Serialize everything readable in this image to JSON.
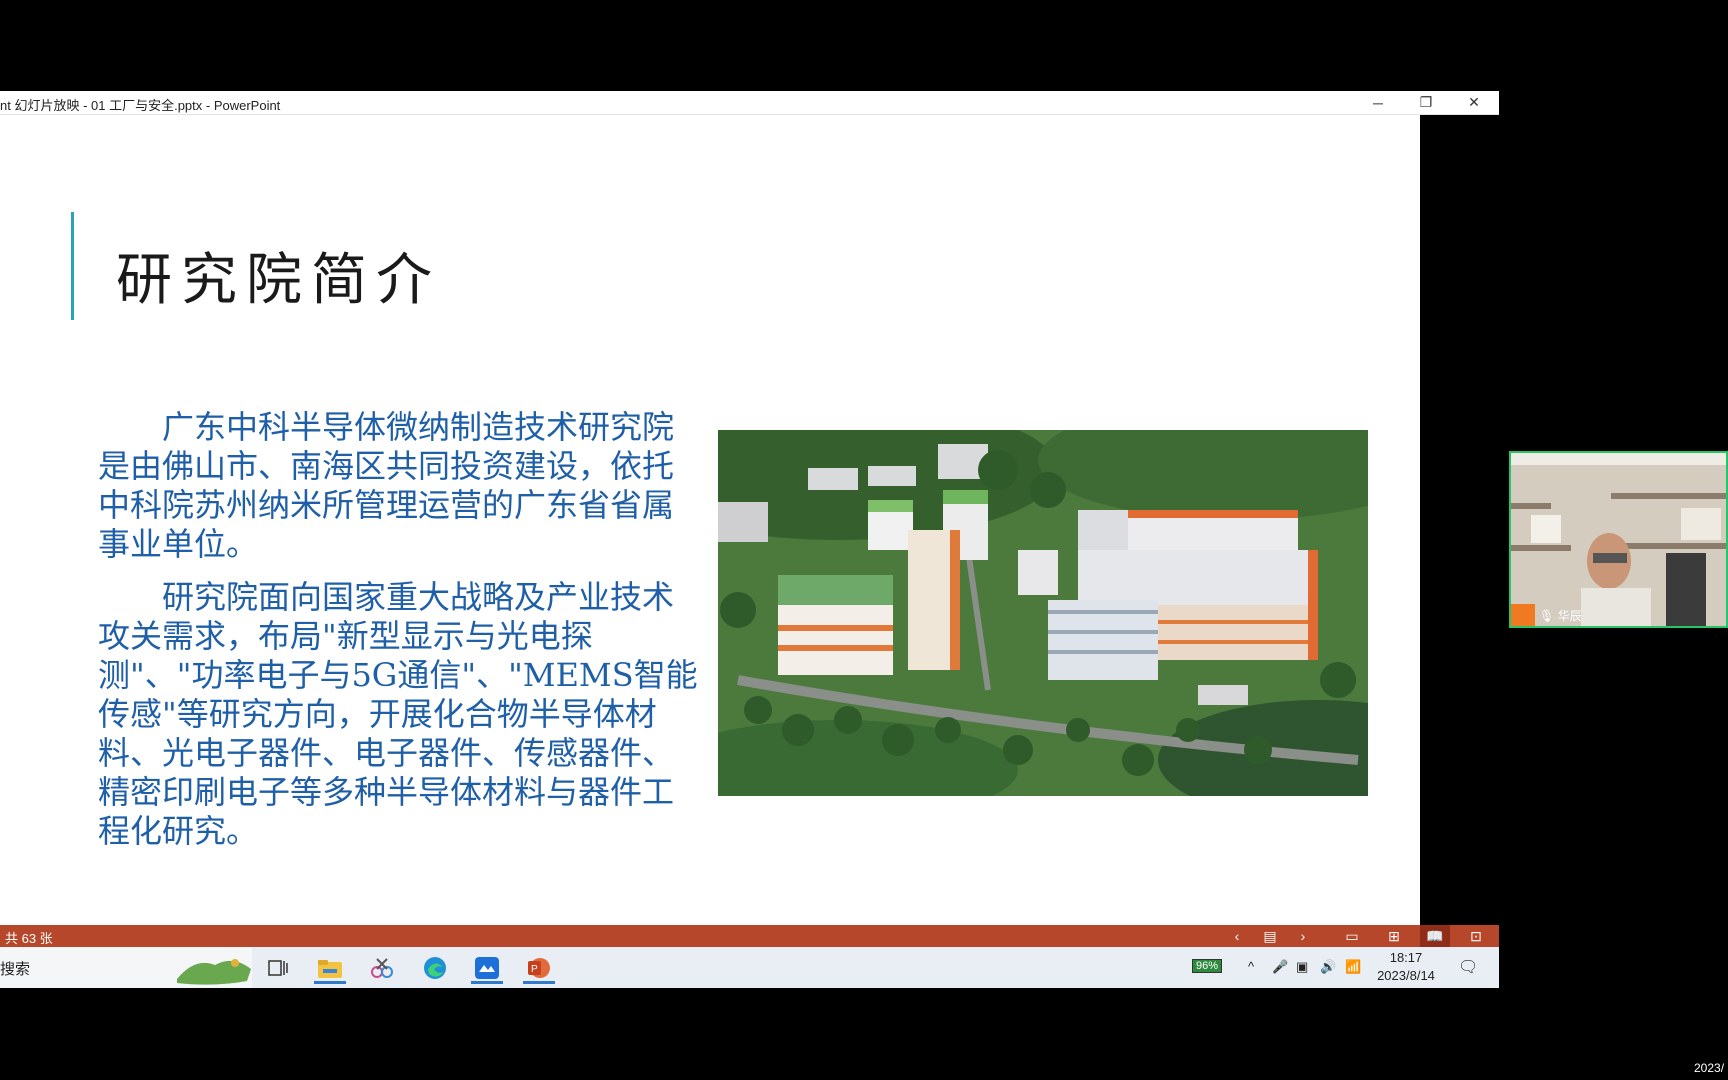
{
  "window": {
    "title": "nt 幻灯片放映  -  01 工厂与安全.pptx  -  PowerPoint",
    "minimize_icon": "─",
    "restore_icon": "❐",
    "close_icon": "✕"
  },
  "slide": {
    "title": "研究院简介",
    "paragraph1": "广东中科半导体微纳制造技术研究院是由佛山市、南海区共同投资建设，依托中科院苏州纳米所管理运营的广东省省属事业单位。",
    "paragraph2": "研究院面向国家重大战略及产业技术攻关需求，布局\"新型显示与光电探测\"、\"功率电子与5G通信\"、\"MEMS智能传感\"等研究方向，开展化合物半导体材料、光电子器件、电子器件、传感器件、精密印刷电子等多种半导体材料与器件工程化研究。",
    "accent_color": "#2aa4b2",
    "text_color": "#1f5fa8"
  },
  "statusbar": {
    "slide_count": "共 63 张",
    "prev_icon": "‹",
    "menu_icon": "▤",
    "next_icon": "›",
    "normal_view_icon": "▭",
    "sorter_view_icon": "⊞",
    "reading_view_icon": "📖",
    "slideshow_icon": "⊡",
    "bar_color": "#b7472a"
  },
  "taskbar": {
    "search_text": "搜索",
    "battery": "96%",
    "time": "18:17",
    "date": "2023/8/14"
  },
  "video": {
    "name_label": "华辰"
  },
  "bottom_right_date": "2023/"
}
